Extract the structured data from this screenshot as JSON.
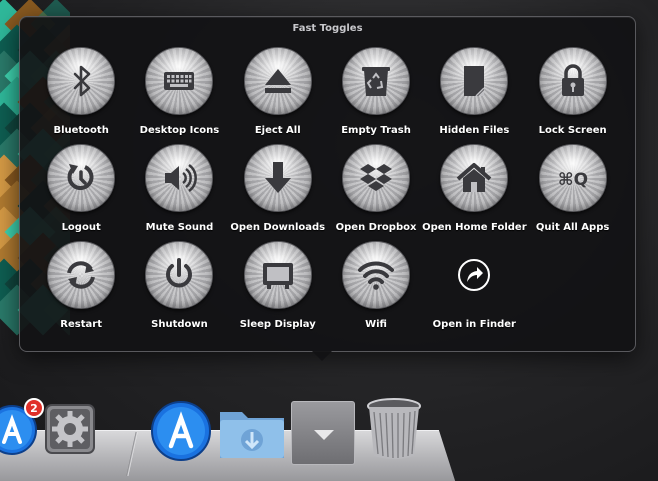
{
  "popup": {
    "title": "Fast Toggles"
  },
  "toggles": [
    {
      "label": "Bluetooth",
      "icon": "bluetooth-icon",
      "id": "bluetooth"
    },
    {
      "label": "Desktop Icons",
      "icon": "keyboard-icon",
      "id": "desktop-icons"
    },
    {
      "label": "Eject All",
      "icon": "eject-icon",
      "id": "eject-all"
    },
    {
      "label": "Empty Trash",
      "icon": "recycle-bin-icon",
      "id": "empty-trash"
    },
    {
      "label": "Hidden Files",
      "icon": "hidden-document-icon",
      "id": "hidden-files"
    },
    {
      "label": "Lock Screen",
      "icon": "padlock-icon",
      "id": "lock-screen"
    },
    {
      "label": "Logout",
      "icon": "logout-arrow-icon",
      "id": "logout"
    },
    {
      "label": "Mute Sound",
      "icon": "speaker-icon",
      "id": "mute-sound"
    },
    {
      "label": "Open Downloads",
      "icon": "down-arrow-icon",
      "id": "open-downloads"
    },
    {
      "label": "Open Dropbox",
      "icon": "dropbox-icon",
      "id": "open-dropbox"
    },
    {
      "label": "Open Home Folder",
      "icon": "house-icon",
      "id": "open-home-folder"
    },
    {
      "label": "Quit All Apps",
      "icon": "command-q-icon",
      "id": "quit-all-apps",
      "glyph": "⌘Q"
    },
    {
      "label": "Restart",
      "icon": "restart-arrows-icon",
      "id": "restart"
    },
    {
      "label": "Shutdown",
      "icon": "power-icon",
      "id": "shutdown"
    },
    {
      "label": "Sleep Display",
      "icon": "display-icon",
      "id": "sleep-display"
    },
    {
      "label": "Wifi",
      "icon": "wifi-icon",
      "id": "wifi"
    },
    {
      "label": "Open in Finder",
      "icon": "share-arrow-icon",
      "id": "open-in-finder"
    }
  ],
  "dock": {
    "app_store_badge": "2",
    "items": [
      "app-store-icon",
      "system-preferences-icon",
      "app-store-icon",
      "downloads-folder-icon",
      "stack-icon",
      "trash-icon"
    ]
  },
  "colors": {
    "popup_bg": "#141416",
    "label_text": "#ffffff",
    "badge_red": "#e0302a",
    "app_store_blue": "#1a72e0",
    "folder_blue": "#7fb3e0",
    "icon_dark": "#3a3a3e"
  }
}
